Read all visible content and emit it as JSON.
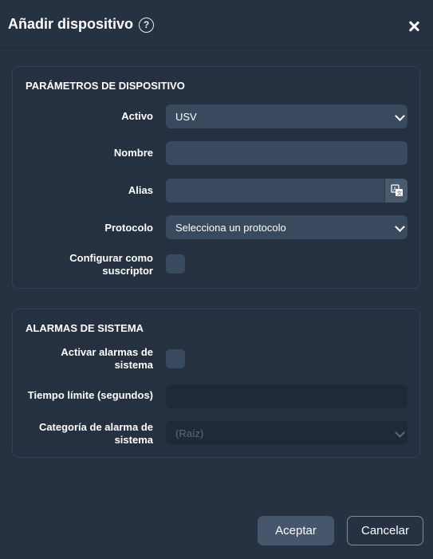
{
  "dialog": {
    "title": "Añadir dispositivo",
    "help_glyph": "?"
  },
  "device_params": {
    "heading": "PARÁMETROS DE DISPOSITIVO",
    "active_label": "Activo",
    "active_value": "USV",
    "name_label": "Nombre",
    "name_value": "",
    "alias_label": "Alias",
    "alias_value": "",
    "protocol_label": "Protocolo",
    "protocol_value": "Selecciona un protocolo",
    "subscriber_label_line1": "Configurar como",
    "subscriber_label_line2": "suscriptor",
    "subscriber_checked": false
  },
  "system_alarms": {
    "heading": "ALARMAS DE SISTEMA",
    "enable_label_line1": "Activar alarmas de",
    "enable_label_line2": "sistema",
    "enable_checked": false,
    "timeout_label": "Tiempo límite (segundos)",
    "timeout_value": "",
    "category_label_line1": "Categoría de alarma de",
    "category_label_line2": "sistema",
    "category_value": "(Raíz)"
  },
  "footer": {
    "accept_label": "Aceptar",
    "cancel_label": "Cancelar"
  },
  "colors": {
    "background": "#263241",
    "field": "#3a4a5e",
    "section_border": "#334152",
    "disabled_text": "#5d6b7b"
  },
  "icons": [
    "help-icon",
    "close-icon",
    "translate-icon",
    "chevron-down-icon"
  ]
}
